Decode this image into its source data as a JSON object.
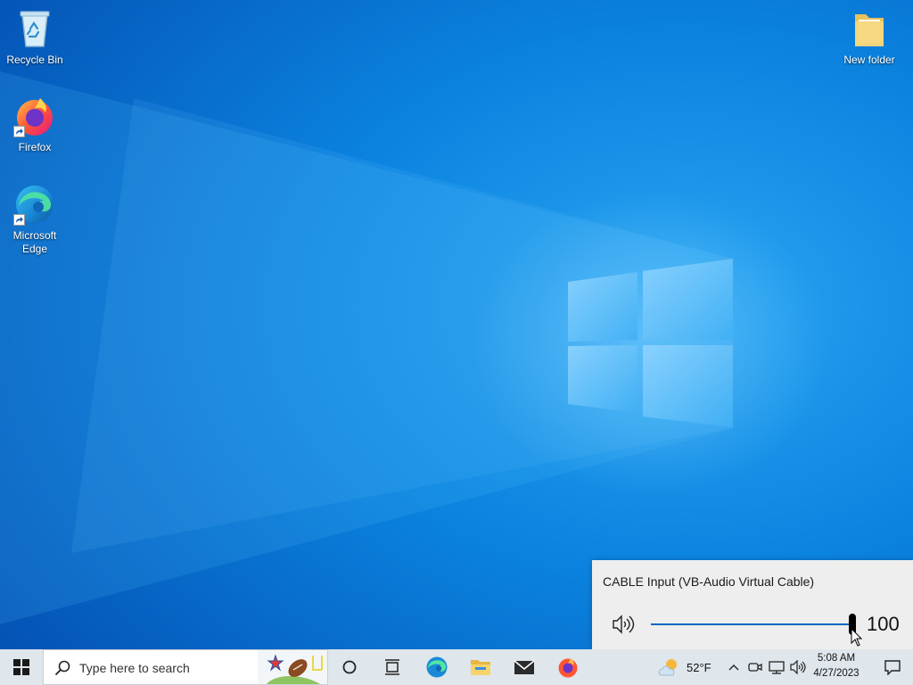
{
  "desktop": {
    "icons": [
      {
        "label": "Recycle Bin",
        "icon": "recycle-bin-icon"
      },
      {
        "label": "Firefox",
        "icon": "firefox-icon"
      },
      {
        "label": "Microsoft Edge",
        "icon": "edge-icon"
      },
      {
        "label": "New folder",
        "icon": "folder-icon"
      }
    ]
  },
  "volume_flyout": {
    "device_name": "CABLE Input (VB-Audio Virtual Cable)",
    "volume_value": "100",
    "volume_level": 1.0
  },
  "taskbar": {
    "search_placeholder": "Type here to search",
    "pinned_apps": [
      "cortana-icon",
      "task-view-icon",
      "edge-icon",
      "file-explorer-icon",
      "mail-icon",
      "firefox-icon"
    ],
    "weather": {
      "temp": "52°F",
      "icon": "partly-cloudy-icon"
    },
    "tray_icons": [
      "chevron-up-icon",
      "meet-now-icon",
      "network-icon",
      "volume-icon"
    ],
    "clock": {
      "time": "5:08 AM",
      "date": "4/27/2023"
    },
    "notification_icon": "action-center-icon"
  },
  "colors": {
    "wallpaper": "#0a78d7",
    "accent": "#0067c0",
    "taskbar": "#dfe6ec",
    "flyout": "#eeeeee"
  }
}
